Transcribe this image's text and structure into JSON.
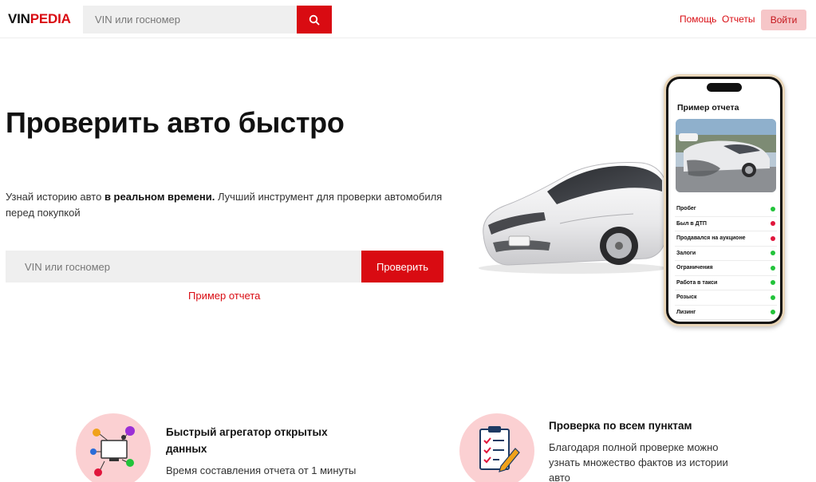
{
  "header": {
    "logo_part1": "VIN",
    "logo_part2": "PEDIA",
    "search_placeholder": "VIN или госномер",
    "nav_help": "Помощь",
    "nav_reports": "Отчеты",
    "login": "Войти"
  },
  "hero": {
    "title": "Проверить авто быстро",
    "subtitle_pre": "Узнай историю авто ",
    "subtitle_bold": "в реальном времени.",
    "subtitle_post": " Лучший инструмент для проверки автомобиля перед покупкой",
    "search_placeholder": "VIN или госномер",
    "check_button": "Проверить",
    "sample_link": "Пример отчета"
  },
  "phone": {
    "title": "Пример отчета",
    "items": [
      {
        "label": "Пробег",
        "status": "ok"
      },
      {
        "label": "Был в ДТП",
        "status": "bad"
      },
      {
        "label": "Продавался на аукционе",
        "status": "bad"
      },
      {
        "label": "Залоги",
        "status": "ok"
      },
      {
        "label": "Ограничения",
        "status": "ok"
      },
      {
        "label": "Работа в такси",
        "status": "ok"
      },
      {
        "label": "Розыск",
        "status": "ok"
      },
      {
        "label": "Лизинг",
        "status": "ok"
      }
    ]
  },
  "features": [
    {
      "title": "Быстрый агрегатор открытых данных",
      "text": "Время составления отчета от 1 минуты",
      "icon": "network-monitor-icon"
    },
    {
      "title": "Проверка по всем пунктам",
      "text": "Благодаря полной проверке можно узнать множество фактов из истории авто",
      "icon": "checklist-clipboard-icon"
    }
  ],
  "colors": {
    "brand_red": "#d90b12",
    "ok_green": "#22c33a",
    "bad_red": "#e0163c",
    "icon_bg": "#fbd0d2"
  }
}
